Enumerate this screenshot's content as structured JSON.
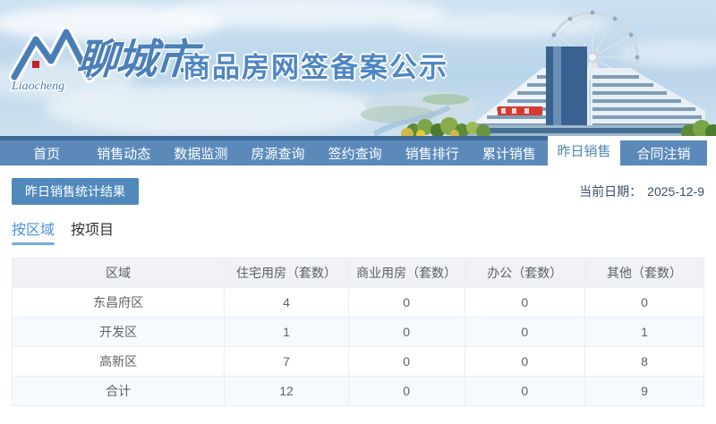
{
  "header": {
    "logo_script": "Liaocheng",
    "city": "聊城市",
    "title": "商品房网签备案公示"
  },
  "nav": {
    "items": [
      "首页",
      "销售动态",
      "数据监测",
      "房源查询",
      "签约查询",
      "销售排行",
      "累计销售",
      "昨日销售",
      "合同注销"
    ],
    "active": "昨日销售"
  },
  "toolbar": {
    "result_button": "昨日销售统计结果",
    "date_label": "当前日期：",
    "date_value": "2025-12-9"
  },
  "tabs": {
    "by_region": "按区域",
    "by_project": "按项目",
    "active": "按区域"
  },
  "table": {
    "headers": [
      "区域",
      "住宅用房（套数）",
      "商业用房（套数）",
      "办公（套数）",
      "其他（套数）"
    ],
    "rows": [
      [
        "东昌府区",
        "4",
        "0",
        "0",
        "0"
      ],
      [
        "开发区",
        "1",
        "0",
        "0",
        "1"
      ],
      [
        "高新区",
        "7",
        "0",
        "0",
        "8"
      ],
      [
        "合计",
        "12",
        "0",
        "0",
        "9"
      ]
    ]
  },
  "colors": {
    "nav_blue": "#5b8aba",
    "nav_top_border": "#3e6896",
    "active_tab_text": "#4d86b6",
    "accent_link": "#4a90e2",
    "button_blue": "#5289bd",
    "table_header_bg": "#f0f2f5",
    "stripe_bg": "#f6f9fd"
  }
}
